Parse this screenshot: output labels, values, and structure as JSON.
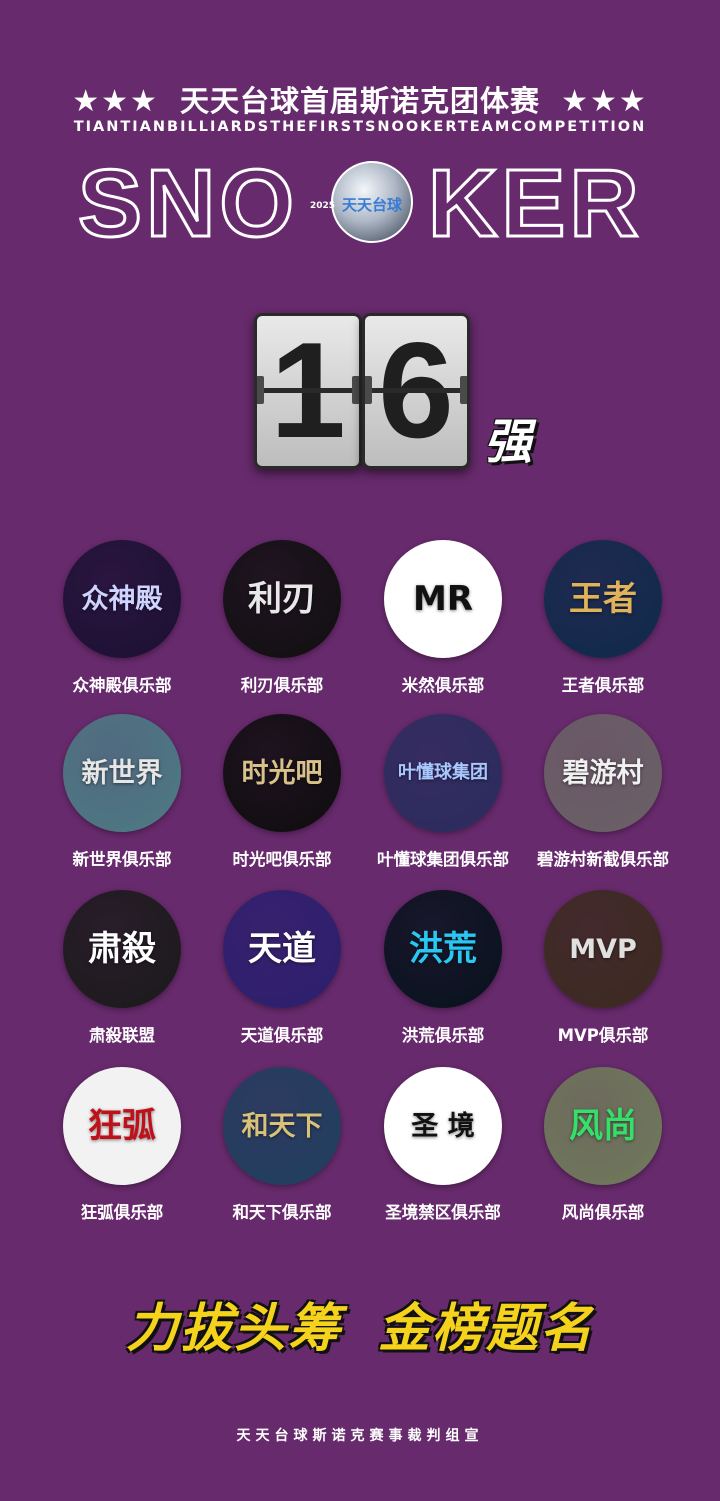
{
  "header": {
    "stars_left": "★★★",
    "title": "天天台球首届斯诺克团体赛",
    "stars_right": "★★★",
    "subtitle": "TIANTIANBILLIARDSTHEFIRSTSNOOKERTEAMCOMPETITION",
    "snooker_left": "SNO",
    "snooker_right": "KER",
    "badge_year": "2025",
    "badge_logo_text": "天天台球"
  },
  "round": {
    "digit1": "1",
    "digit2": "6",
    "suffix": "强"
  },
  "clubs": [
    {
      "name": "众神殿俱乐部",
      "logo_text": "众神殿",
      "logo_bg": "#1b1033",
      "logo_color": "#cfd3ff"
    },
    {
      "name": "利刃俱乐部",
      "logo_text": "利刃",
      "logo_bg": "#0f0f0f",
      "logo_color": "#e8e8e8"
    },
    {
      "name": "米然俱乐部",
      "logo_text": "MR",
      "logo_bg": "#ffffff",
      "logo_color": "#111111"
    },
    {
      "name": "王者俱乐部",
      "logo_text": "王者",
      "logo_bg": "#0e2a4a",
      "logo_color": "#e0b25a"
    },
    {
      "name": "新世界俱乐部",
      "logo_text": "新世界",
      "logo_bg": "#4c7a84",
      "logo_color": "#e6e6e6"
    },
    {
      "name": "时光吧俱乐部",
      "logo_text": "时光吧",
      "logo_bg": "#0d0d0d",
      "logo_color": "#d9c28a"
    },
    {
      "name": "叶懂球集团俱乐部",
      "logo_text": "叶懂球集团",
      "logo_bg": "#2a2c5e",
      "logo_color": "#a8c8ff"
    },
    {
      "name": "碧游村新截俱乐部",
      "logo_text": "碧游村",
      "logo_bg": "#6a6266",
      "logo_color": "#f0f0f0"
    },
    {
      "name": "肃殺联盟",
      "logo_text": "肃殺",
      "logo_bg": "#1a1a1a",
      "logo_color": "#ffffff"
    },
    {
      "name": "天道俱乐部",
      "logo_text": "天道",
      "logo_bg": "#2b1f6e",
      "logo_color": "#ffffff"
    },
    {
      "name": "洪荒俱乐部",
      "logo_text": "洪荒",
      "logo_bg": "#06121c",
      "logo_color": "#29c7f2"
    },
    {
      "name": "MVP俱乐部",
      "logo_text": "MVP",
      "logo_bg": "#3b2a1e",
      "logo_color": "#e0e0e0"
    },
    {
      "name": "狂弧俱乐部",
      "logo_text": "狂弧",
      "logo_bg": "#f2f2f2",
      "logo_color": "#c0101a"
    },
    {
      "name": "和天下俱乐部",
      "logo_text": "和天下",
      "logo_bg": "#1f3f5e",
      "logo_color": "#d8c27a"
    },
    {
      "name": "圣境禁区俱乐部",
      "logo_text": "圣 境",
      "logo_bg": "#ffffff",
      "logo_color": "#111111"
    },
    {
      "name": "风尚俱乐部",
      "logo_text": "风尚",
      "logo_bg": "#6f7a5a",
      "logo_color": "#35e06a"
    }
  ],
  "slogan": {
    "part1": "力拔头筹",
    "part2": "金榜题名"
  },
  "footer": "天天台球斯诺克赛事裁判组宣",
  "colors": {
    "background": "#672a6c",
    "slogan": "#f5d21b"
  }
}
